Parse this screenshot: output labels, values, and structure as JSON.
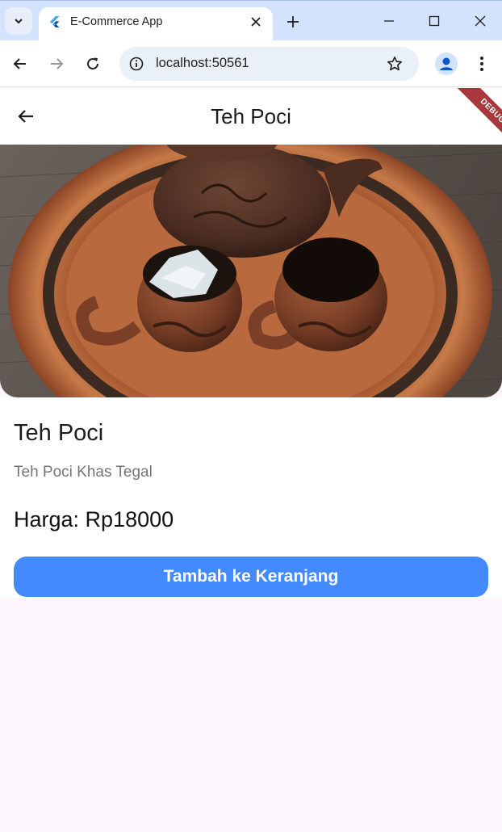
{
  "browser": {
    "tab_title": "E-Commerce App",
    "url": "localhost:50561",
    "icons": [
      "tab-search-icon",
      "flutter-favicon",
      "close-icon",
      "plus-icon",
      "minimize-icon",
      "maximize-icon",
      "window-close-icon",
      "back-arrow-icon",
      "forward-arrow-icon",
      "reload-icon",
      "info-icon",
      "star-icon",
      "profile-icon",
      "menu-dots-icon"
    ]
  },
  "app": {
    "title": "Teh Poci",
    "debug_label": "DEBUG",
    "accent_color": "#448aff"
  },
  "product": {
    "name": "Teh Poci",
    "description": "Teh Poci Khas Tegal",
    "price": "Harga: Rp18000",
    "add_to_cart_label": "Tambah ke Keranjang"
  }
}
